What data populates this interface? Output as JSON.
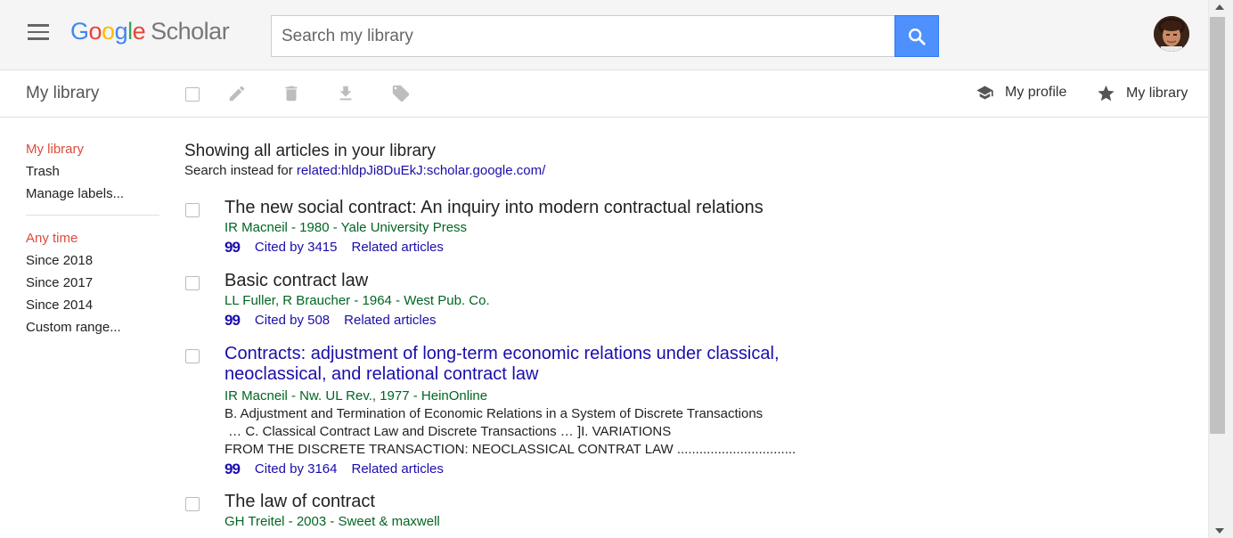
{
  "header": {
    "logo": {
      "g1": "G",
      "g2": "o",
      "g3": "o",
      "g4": "g",
      "g5": "l",
      "g6": "e",
      "product": "Scholar"
    },
    "search_placeholder": "Search my library",
    "search_value": ""
  },
  "toolbar": {
    "title": "My library",
    "my_profile": "My profile",
    "my_library": "My library"
  },
  "sidebar": {
    "primary": [
      {
        "label": "My library",
        "active": true
      },
      {
        "label": "Trash",
        "active": false
      },
      {
        "label": "Manage labels...",
        "active": false
      }
    ],
    "time": [
      {
        "label": "Any time",
        "active": true
      },
      {
        "label": "Since 2018",
        "active": false
      },
      {
        "label": "Since 2017",
        "active": false
      },
      {
        "label": "Since 2014",
        "active": false
      },
      {
        "label": "Custom range...",
        "active": false
      }
    ]
  },
  "main": {
    "showing": "Showing all articles in your library",
    "search_instead_prefix": "Search instead for",
    "search_instead_link": "related:hldpJi8DuEkJ:scholar.google.com/",
    "results": [
      {
        "title": "The new social contract: An inquiry into modern contractual relations",
        "meta": "IR Macneil - 1980 - Yale University Press",
        "cite_icon": "99",
        "cited_by": "Cited by 3415",
        "related": "Related articles"
      },
      {
        "title": "Basic contract law",
        "meta": "LL Fuller, R Braucher - 1964 - West Pub. Co.",
        "cite_icon": "99",
        "cited_by": "Cited by 508",
        "related": "Related articles"
      },
      {
        "title_line1": "Contracts: adjustment of long-term economic relations under classical,",
        "title_line2": "neoclassical, and relational contract law",
        "meta": "IR Macneil - Nw. UL Rev., 1977 - HeinOnline",
        "snippet1": "B. Adjustment and Termination of Economic Relations in a System of Discrete Transactions",
        "snippet2": " … C. Classical Contract Law and Discrete Transactions … ]I. VARIATIONS",
        "snippet3": "FROM THE DISCRETE TRANSACTION: NEOCLASSICAL CONTRAT LAW ................................",
        "cite_icon": "99",
        "cited_by": "Cited by 3164",
        "related": "Related articles"
      },
      {
        "title": "The law of contract",
        "meta": "GH Treitel - 2003 - Sweet & maxwell"
      }
    ]
  },
  "colors": {
    "link": "#1a0dab",
    "meta_green": "#006621",
    "active_red": "#dd4b39",
    "search_blue": "#4d90fe"
  }
}
